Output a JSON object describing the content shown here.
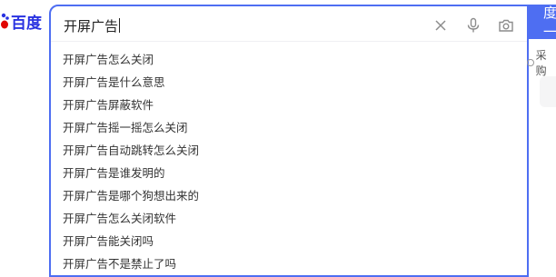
{
  "logo": {
    "text": "百度"
  },
  "search": {
    "query": "开屏广告",
    "button_label": "百度一下"
  },
  "suggestions": [
    "开屏广告怎么关闭",
    "开屏广告是什么意思",
    "开屏广告屏蔽软件",
    "开屏广告摇一摇怎么关闭",
    "开屏广告自动跳转怎么关闭",
    "开屏广告是谁发明的",
    "开屏广告是哪个狗想出来的",
    "开屏广告怎么关闭软件",
    "开屏广告能关闭吗",
    "开屏广告不是禁止了吗"
  ],
  "side": {
    "label": "采购"
  },
  "colors": {
    "accent": "#4e6ef2",
    "logo_blue": "#2932e1",
    "logo_red": "#e10602"
  },
  "icons": [
    "baidu-paw-icon",
    "clear-icon",
    "microphone-icon",
    "camera-icon"
  ]
}
